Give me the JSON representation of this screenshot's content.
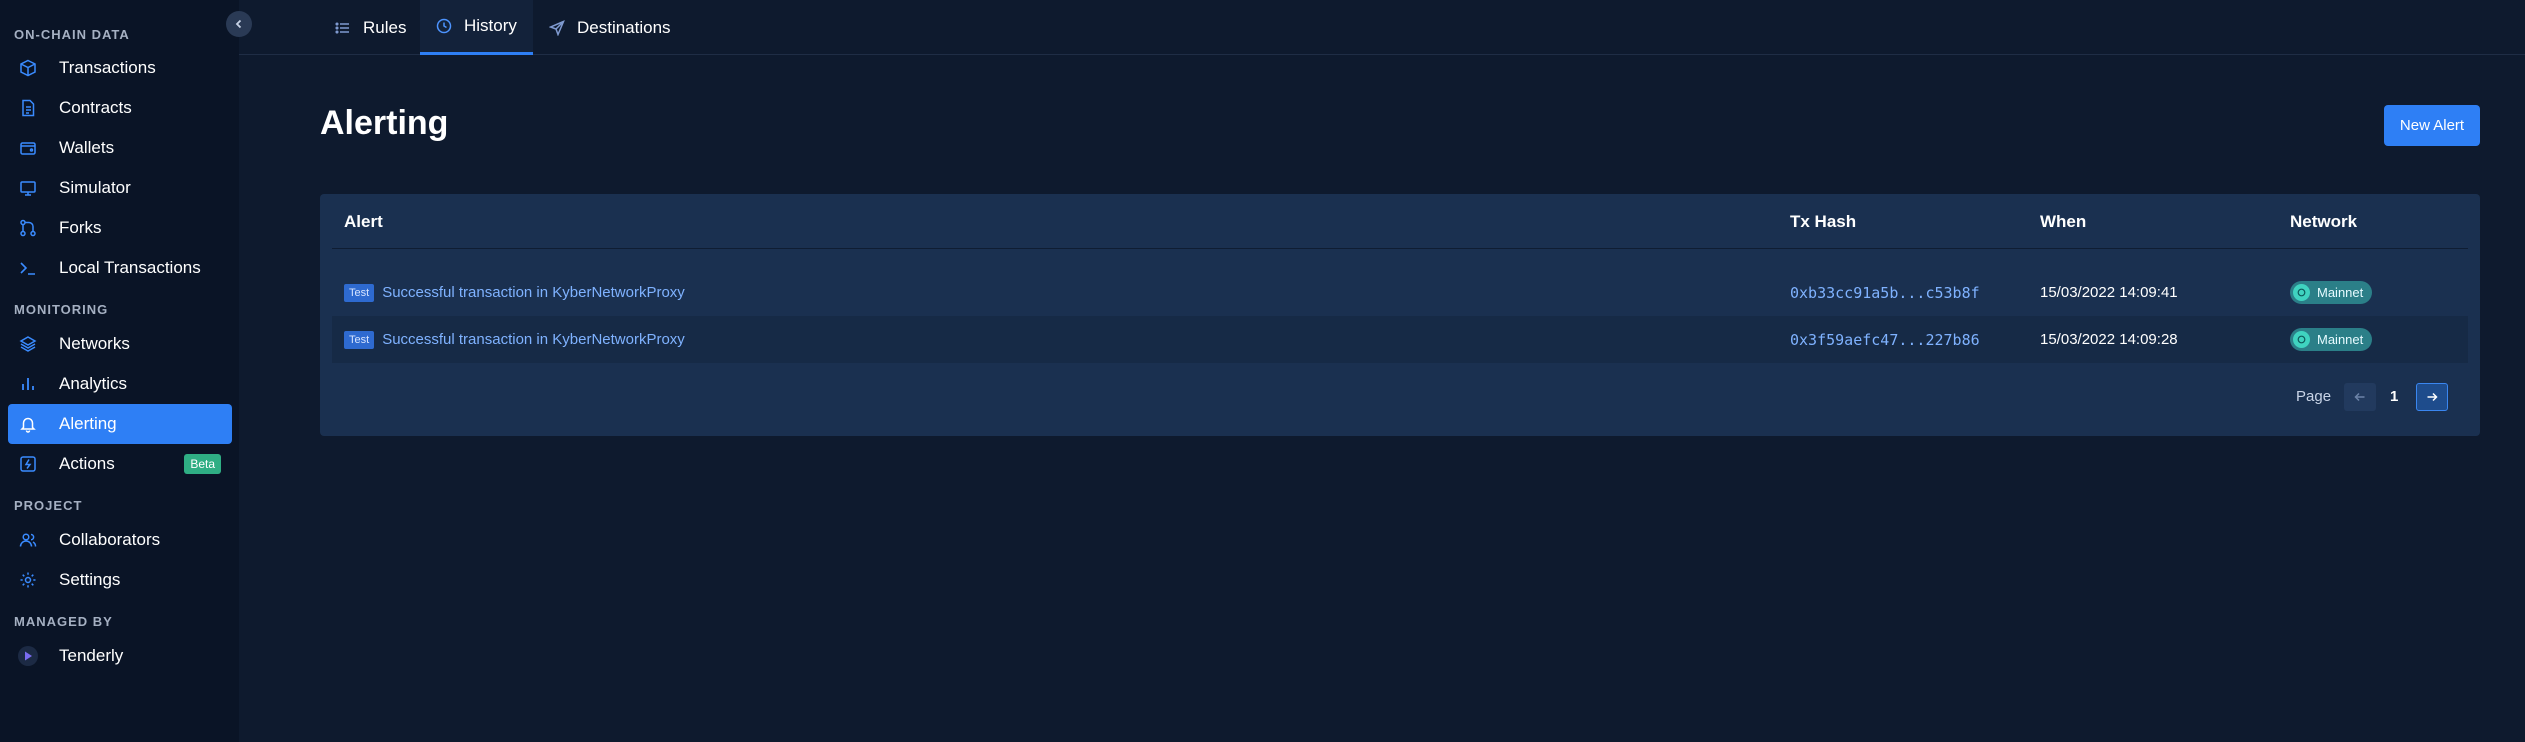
{
  "sidebar": {
    "sections": {
      "onchain": "ON-CHAIN DATA",
      "monitoring": "MONITORING",
      "project": "PROJECT",
      "managed_by": "MANAGED BY"
    },
    "items": {
      "transactions": "Transactions",
      "contracts": "Contracts",
      "wallets": "Wallets",
      "simulator": "Simulator",
      "forks": "Forks",
      "local_transactions": "Local Transactions",
      "networks": "Networks",
      "analytics": "Analytics",
      "alerting": "Alerting",
      "actions": "Actions",
      "collaborators": "Collaborators",
      "settings": "Settings",
      "tenderly": "Tenderly"
    },
    "actions_badge": "Beta",
    "active_item": "Alerting"
  },
  "tabs": {
    "rules": "Rules",
    "history": "History",
    "destinations": "Destinations",
    "active": "History"
  },
  "page": {
    "title": "Alerting",
    "new_alert_label": "New Alert"
  },
  "table": {
    "headers": {
      "alert": "Alert",
      "tx_hash": "Tx Hash",
      "when": "When",
      "network": "Network"
    },
    "rows": [
      {
        "tag": "Test",
        "alert": "Successful transaction in KyberNetworkProxy",
        "tx_hash": "0xb33cc91a5b...c53b8f",
        "when": "15/03/2022 14:09:41",
        "network": "Mainnet"
      },
      {
        "tag": "Test",
        "alert": "Successful transaction in KyberNetworkProxy",
        "tx_hash": "0x3f59aefc47...227b86",
        "when": "15/03/2022 14:09:28",
        "network": "Mainnet"
      }
    ]
  },
  "pagination": {
    "label": "Page",
    "current": "1"
  },
  "colors": {
    "background": "#0e1a2e",
    "sidebar": "#0a1426",
    "accent": "#2e7ff5",
    "card": "#1a3050",
    "link": "#7fb2ff",
    "beta": "#2fae84",
    "network_pill": "#2b7f88"
  }
}
